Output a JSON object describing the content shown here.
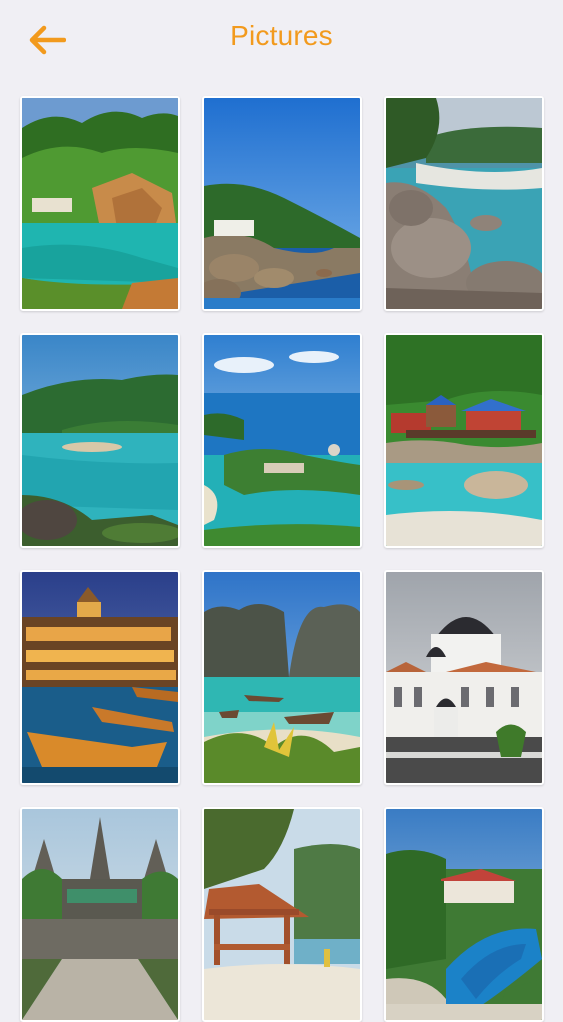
{
  "header": {
    "title": "Pictures",
    "back_icon": "arrow-left-icon",
    "accent_color": "#f29a1d"
  },
  "gallery": {
    "items": [
      {
        "name": "pool-jungle-cliff"
      },
      {
        "name": "rocky-island-coast"
      },
      {
        "name": "boulders-beach"
      },
      {
        "name": "turquoise-bay-hills"
      },
      {
        "name": "tropical-island-aerial"
      },
      {
        "name": "stilt-houses-beach"
      },
      {
        "name": "resort-night-boats"
      },
      {
        "name": "limestone-cliffs-boats"
      },
      {
        "name": "white-mosque"
      },
      {
        "name": "angkor-temple"
      },
      {
        "name": "beach-pavilion"
      },
      {
        "name": "resort-pool-aerial"
      }
    ]
  }
}
